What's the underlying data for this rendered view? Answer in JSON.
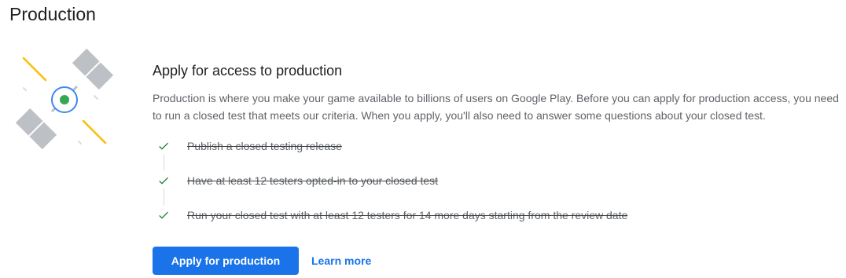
{
  "page": {
    "title": "Production"
  },
  "production_card": {
    "illustration_icon": "satellite-icon",
    "heading": "Apply for access to production",
    "description": "Production is where you make your game available to billions of users on Google Play. Before you can apply for production access, you need to run a closed test that meets our criteria. When you apply, you'll also need to answer some questions about your closed test.",
    "checklist": [
      {
        "label": "Publish a closed testing release",
        "completed": true,
        "icon": "check-icon"
      },
      {
        "label": "Have at least 12 testers opted-in to your closed test",
        "completed": true,
        "icon": "check-icon"
      },
      {
        "label": "Run your closed test with at least 12 testers for 14 more days starting from the review date",
        "completed": true,
        "icon": "check-icon"
      }
    ],
    "actions": {
      "apply_label": "Apply for production",
      "learn_more_label": "Learn more"
    }
  },
  "colors": {
    "primary": "#1a73e8",
    "check": "#188038",
    "text_primary": "#202124",
    "text_secondary": "#5f6368",
    "satellite_panel": "#bdc1c6",
    "orbit_accent": "#fbbc04",
    "status_dot": "#34a853"
  }
}
